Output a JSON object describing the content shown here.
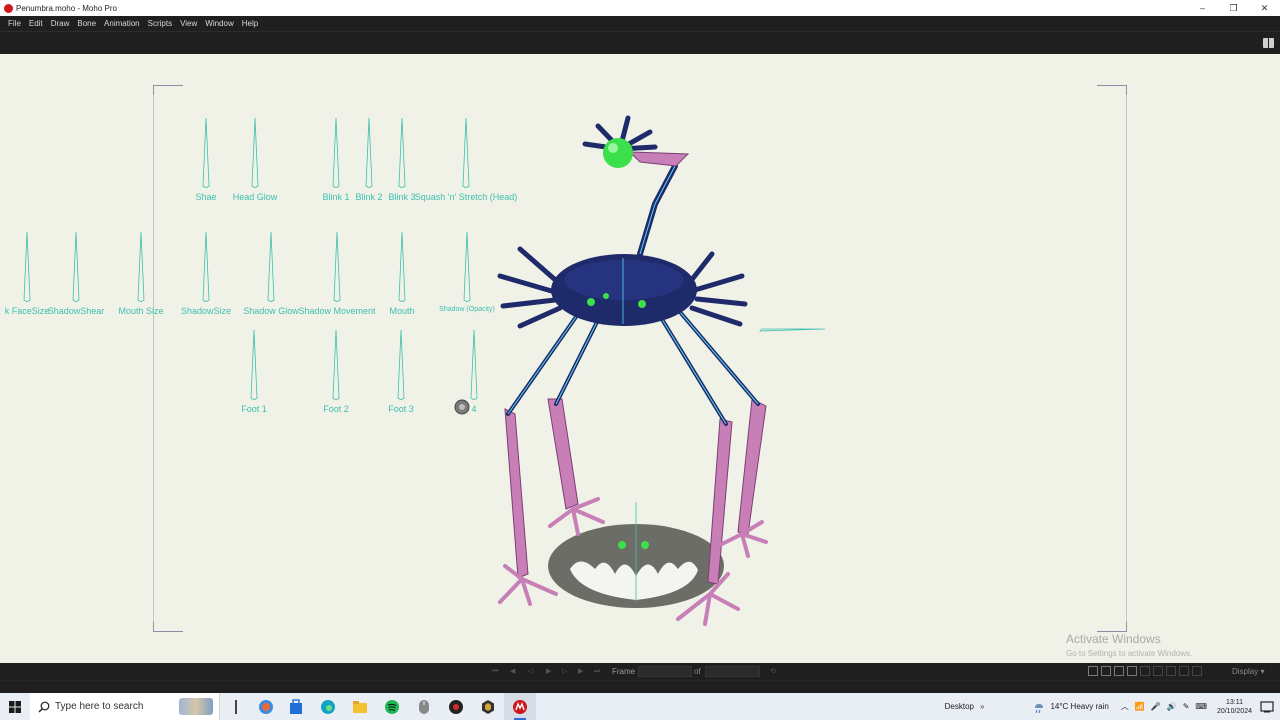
{
  "window": {
    "title": "Penumbra.moho - Moho Pro",
    "controls": [
      "–",
      "❐",
      "✕"
    ]
  },
  "menu": [
    "File",
    "Edit",
    "Draw",
    "Bone",
    "Animation",
    "Scripts",
    "View",
    "Window",
    "Help"
  ],
  "canvas": {
    "switch_labels": {
      "shae": "Shae",
      "head_glow": "Head Glow",
      "blink_1": "Blink 1",
      "blink_2": "Blink 2",
      "blink_3": "Blink 3",
      "squash_head": "Squash 'n' Stretch (Head)",
      "face_size": "k FaceSize",
      "shadow_shear": "ShadowShear",
      "mouth_size": "Mouth Size",
      "shadow_size": "ShadowSize",
      "shadow_glow": "Shadow Glow",
      "shadow_movement": "Shadow Movement",
      "mouth": "Mouth",
      "shadow_opacity": "Shadow (Opacity)",
      "foot_1": "Foot 1",
      "foot_2": "Foot 2",
      "foot_3": "Foot 3",
      "foot_4": "4"
    },
    "watermark": {
      "title": "Activate Windows",
      "subtitle": "Go to Settings to activate Windows."
    }
  },
  "timeline": {
    "frame_label": "Frame",
    "frame_value": "",
    "of_label": "of",
    "total_frames": "",
    "display_label": "Display"
  },
  "taskbar": {
    "search_placeholder": "Type here to search",
    "desktop_label": "Desktop",
    "weather": "14°C  Heavy rain",
    "time": "13:11",
    "date": "20/10/2024"
  },
  "colors": {
    "accent_teal": "#3dbfae",
    "bone_blue": "#1f2a6b",
    "limb_pink": "#c87fb8",
    "glow_green": "#3be04a"
  }
}
